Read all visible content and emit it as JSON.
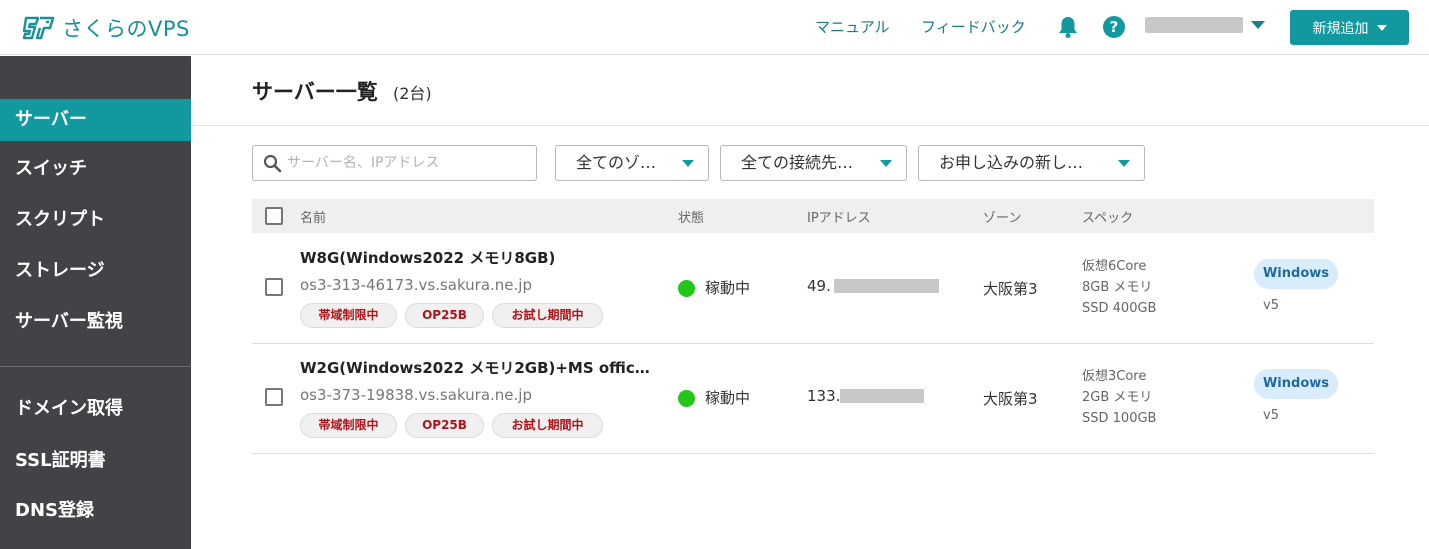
{
  "header": {
    "logo_text": "さくらのVPS",
    "links": [
      "マニュアル",
      "フィードバック"
    ],
    "new_button": "新規追加"
  },
  "sidebar": {
    "items": [
      {
        "label": "サーバー",
        "active": true
      },
      {
        "label": "スイッチ"
      },
      {
        "label": "スクリプト"
      },
      {
        "label": "ストレージ"
      },
      {
        "label": "サーバー監視"
      },
      {
        "label": "ドメイン取得"
      },
      {
        "label": "SSL証明書"
      },
      {
        "label": "DNS登録"
      }
    ]
  },
  "main": {
    "title": "サーバー一覧",
    "count": "(2台)",
    "search": {
      "placeholder": "サーバー名、IPアドレス",
      "value": ""
    },
    "filters": [
      "全てのゾ…",
      "全ての接続先…",
      "お申し込みの新し…"
    ],
    "columns": [
      "名前",
      "状態",
      "IPアドレス",
      "ゾーン",
      "スペック"
    ],
    "rows": [
      {
        "name": "W8G(Windows2022 メモリ8GB)",
        "host": "os3-313-46173.vs.sakura.ne.jp",
        "tags": [
          "帯域制限中",
          "OP25B",
          "お試し期間中"
        ],
        "status": "稼動中",
        "ip": "49.",
        "zone": "大阪第3",
        "spec": [
          "仮想6Core",
          "8GB メモリ",
          "SSD 400GB"
        ],
        "os": "Windows",
        "version": "v5"
      },
      {
        "name": "W2G(Windows2022 メモリ2GB)+MS offic…",
        "host": "os3-373-19838.vs.sakura.ne.jp",
        "tags": [
          "帯域制限中",
          "OP25B",
          "お試し期間中"
        ],
        "status": "稼動中",
        "ip": "133.",
        "zone": "大阪第3",
        "spec": [
          "仮想3Core",
          "2GB メモリ",
          "SSD 100GB"
        ],
        "os": "Windows",
        "version": "v5"
      }
    ]
  },
  "colors": {
    "brand": "#12999f",
    "sidebar_bg": "#434347",
    "status_running": "#22c718",
    "tag_text": "#b0141b",
    "os_badge_bg": "#d8ecfb"
  },
  "icons": [
    "sakura-logo-icon",
    "bell-icon",
    "help-icon",
    "search-icon",
    "chevron-down-icon"
  ]
}
